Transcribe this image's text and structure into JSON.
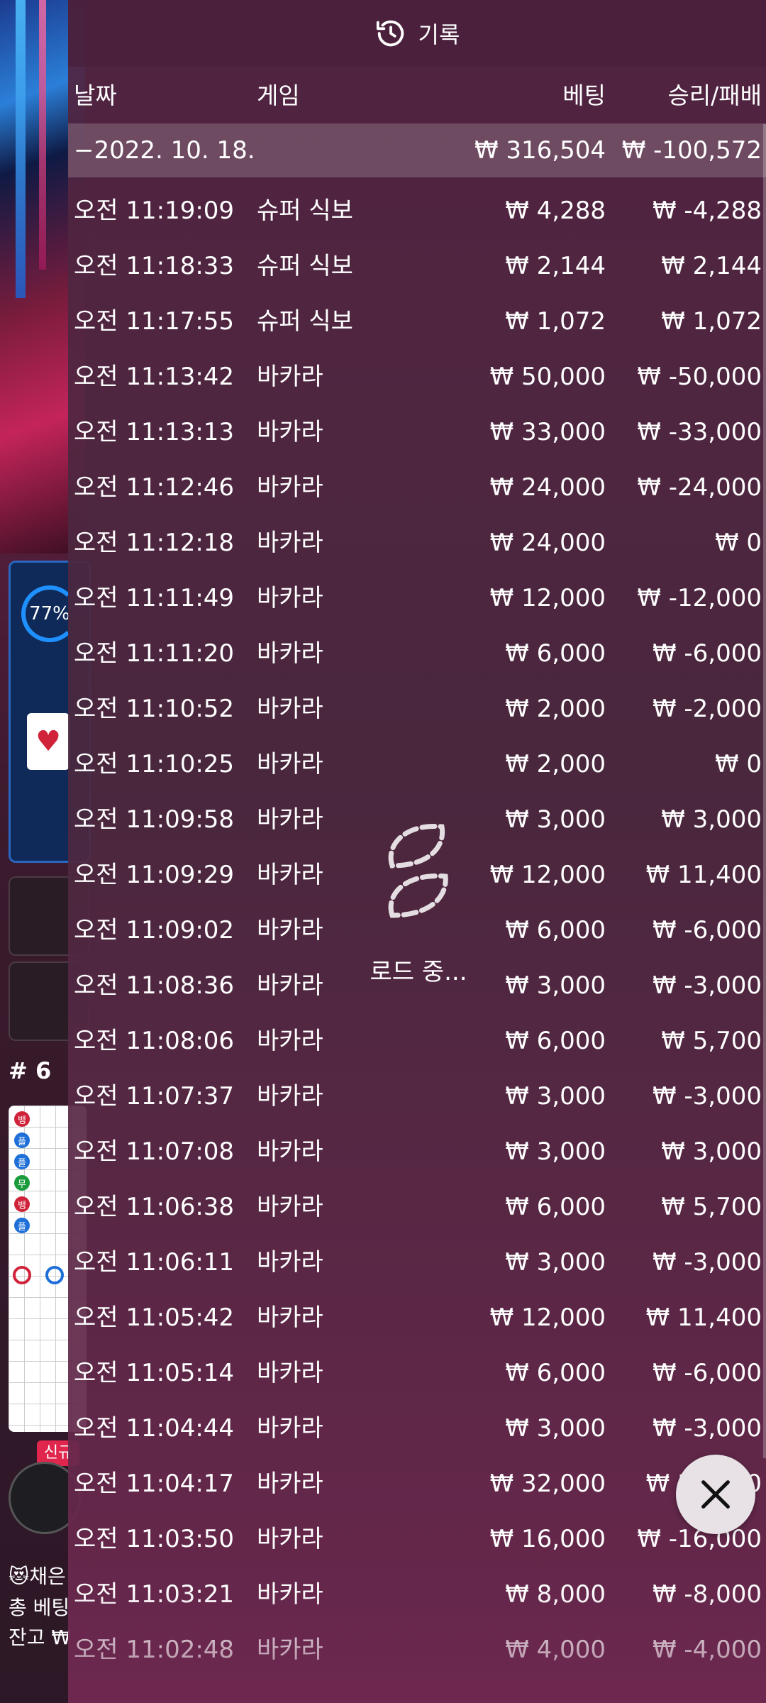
{
  "background": {
    "timer": "77%",
    "label": "# 6",
    "new_badge": "신규",
    "chat_line": "😻채은",
    "total_bet_label": "총 베팅",
    "balance_label": "잔고 ₩"
  },
  "panel": {
    "title": "기록",
    "columns": {
      "date": "날짜",
      "game": "게임",
      "bet": "베팅",
      "result": "승리/패배"
    },
    "date_group": {
      "date": "−2022. 10. 18.",
      "bet": "₩ 316,504",
      "result": "₩ -100,572"
    },
    "rows": [
      {
        "time": "오전 11:19:09",
        "game": "슈퍼 식보",
        "bet": "₩ 4,288",
        "result": "₩ -4,288"
      },
      {
        "time": "오전 11:18:33",
        "game": "슈퍼 식보",
        "bet": "₩ 2,144",
        "result": "₩ 2,144"
      },
      {
        "time": "오전 11:17:55",
        "game": "슈퍼 식보",
        "bet": "₩ 1,072",
        "result": "₩ 1,072"
      },
      {
        "time": "오전 11:13:42",
        "game": "바카라",
        "bet": "₩ 50,000",
        "result": "₩ -50,000"
      },
      {
        "time": "오전 11:13:13",
        "game": "바카라",
        "bet": "₩ 33,000",
        "result": "₩ -33,000"
      },
      {
        "time": "오전 11:12:46",
        "game": "바카라",
        "bet": "₩ 24,000",
        "result": "₩ -24,000"
      },
      {
        "time": "오전 11:12:18",
        "game": "바카라",
        "bet": "₩ 24,000",
        "result": "₩ 0"
      },
      {
        "time": "오전 11:11:49",
        "game": "바카라",
        "bet": "₩ 12,000",
        "result": "₩ -12,000"
      },
      {
        "time": "오전 11:11:20",
        "game": "바카라",
        "bet": "₩ 6,000",
        "result": "₩ -6,000"
      },
      {
        "time": "오전 11:10:52",
        "game": "바카라",
        "bet": "₩ 2,000",
        "result": "₩ -2,000"
      },
      {
        "time": "오전 11:10:25",
        "game": "바카라",
        "bet": "₩ 2,000",
        "result": "₩ 0"
      },
      {
        "time": "오전 11:09:58",
        "game": "바카라",
        "bet": "₩ 3,000",
        "result": "₩ 3,000"
      },
      {
        "time": "오전 11:09:29",
        "game": "바카라",
        "bet": "₩ 12,000",
        "result": "₩ 11,400"
      },
      {
        "time": "오전 11:09:02",
        "game": "바카라",
        "bet": "₩ 6,000",
        "result": "₩ -6,000"
      },
      {
        "time": "오전 11:08:36",
        "game": "바카라",
        "bet": "₩ 3,000",
        "result": "₩ -3,000"
      },
      {
        "time": "오전 11:08:06",
        "game": "바카라",
        "bet": "₩ 6,000",
        "result": "₩ 5,700"
      },
      {
        "time": "오전 11:07:37",
        "game": "바카라",
        "bet": "₩ 3,000",
        "result": "₩ -3,000"
      },
      {
        "time": "오전 11:07:08",
        "game": "바카라",
        "bet": "₩ 3,000",
        "result": "₩ 3,000"
      },
      {
        "time": "오전 11:06:38",
        "game": "바카라",
        "bet": "₩ 6,000",
        "result": "₩ 5,700"
      },
      {
        "time": "오전 11:06:11",
        "game": "바카라",
        "bet": "₩ 3,000",
        "result": "₩ -3,000"
      },
      {
        "time": "오전 11:05:42",
        "game": "바카라",
        "bet": "₩ 12,000",
        "result": "₩ 11,400"
      },
      {
        "time": "오전 11:05:14",
        "game": "바카라",
        "bet": "₩ 6,000",
        "result": "₩ -6,000"
      },
      {
        "time": "오전 11:04:44",
        "game": "바카라",
        "bet": "₩ 3,000",
        "result": "₩ -3,000"
      },
      {
        "time": "오전 11:04:17",
        "game": "바카라",
        "bet": "₩ 32,000",
        "result": "₩ 32,000"
      },
      {
        "time": "오전 11:03:50",
        "game": "바카라",
        "bet": "₩ 16,000",
        "result": "₩ -16,000"
      },
      {
        "time": "오전 11:03:21",
        "game": "바카라",
        "bet": "₩ 8,000",
        "result": "₩ -8,000"
      },
      {
        "time": "오전 11:02:48",
        "game": "바카라",
        "bet": "₩ 4,000",
        "result": "₩ -4,000"
      }
    ],
    "loading_text": "로드 중..."
  },
  "icons": {
    "title": "history-icon",
    "close": "close-icon",
    "loader": "loading-spinner-icon"
  }
}
